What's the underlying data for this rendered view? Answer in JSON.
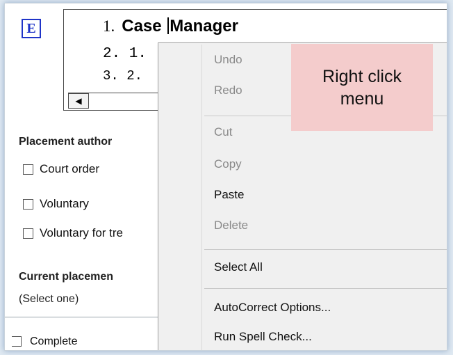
{
  "editor": {
    "badge": "E",
    "line1": {
      "number": "1.",
      "text_before_caret": "Case ",
      "text_after_caret": "Manager"
    },
    "line2": "2. 1.",
    "line3": "3. 2.",
    "scroll_left_arrow": "◀"
  },
  "form": {
    "placement_title": "Placement author",
    "checkboxes": [
      "Court order",
      "Voluntary",
      "Voluntary for tre"
    ],
    "current_title": "Current placemen",
    "select_hint": "(Select one)",
    "complete_label": "Complete"
  },
  "context_menu": {
    "items": [
      {
        "label": "Undo",
        "enabled": false
      },
      {
        "label": "Redo",
        "enabled": false
      },
      {
        "label": "Cut",
        "enabled": false
      },
      {
        "label": "Copy",
        "enabled": false
      },
      {
        "label": "Paste",
        "enabled": true
      },
      {
        "label": "Delete",
        "enabled": false
      },
      {
        "label": "Select All",
        "enabled": true
      },
      {
        "label": "AutoCorrect Options...",
        "enabled": true
      },
      {
        "label": "Run Spell Check...",
        "enabled": true
      }
    ]
  },
  "annotation": {
    "text": "Right click\nmenu"
  },
  "colors": {
    "badge": "#1f34c8",
    "annotation_bg": "#f4cccc",
    "disabled_text": "#8a8a8a",
    "menu_bg": "#f0f0f0"
  }
}
